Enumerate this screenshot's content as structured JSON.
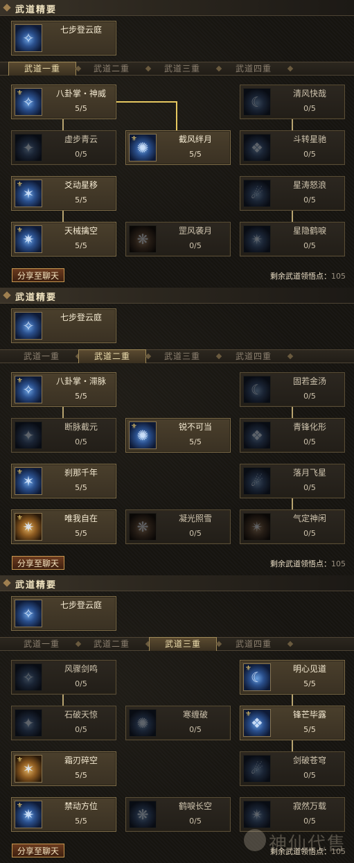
{
  "panels": [
    {
      "header": "武道精要",
      "top_skill": {
        "name": "七步登云庭",
        "icon": "cloud-step-icon"
      },
      "tabs": [
        "武道一重",
        "武道二重",
        "武道三重",
        "武道四重"
      ],
      "active_tab": 0,
      "skills": [
        {
          "name": "八卦掌・神威",
          "level": "5/5",
          "icon": "bagua-palm-icon"
        },
        {
          "name": "清风快哉",
          "level": "0/5",
          "icon": "breeze-icon"
        },
        {
          "name": "虚步青云",
          "level": "0/5",
          "icon": "void-step-icon"
        },
        {
          "name": "截风绊月",
          "level": "5/5",
          "icon": "wind-moon-icon"
        },
        {
          "name": "斗转星驰",
          "level": "0/5",
          "icon": "star-dash-icon"
        },
        {
          "name": "爻动星移",
          "level": "5/5",
          "icon": "star-shift-icon"
        },
        {
          "name": "星涛怒浪",
          "level": "0/5",
          "icon": "star-wave-icon"
        },
        {
          "name": "天械擒空",
          "level": "5/5",
          "icon": "sky-grab-icon"
        },
        {
          "name": "罡风袭月",
          "level": "0/5",
          "icon": "gale-moon-icon"
        },
        {
          "name": "星隐鹤唳",
          "level": "0/5",
          "icon": "crane-cry-icon"
        }
      ],
      "share_label": "分享至聊天",
      "remain_label": "剩余武道领悟点：",
      "remain_value": "105"
    },
    {
      "header": "武道精要",
      "top_skill": {
        "name": "七步登云庭",
        "icon": "cloud-step-icon"
      },
      "tabs": [
        "武道一重",
        "武道二重",
        "武道三重",
        "武道四重"
      ],
      "active_tab": 1,
      "skills": [
        {
          "name": "八卦掌・滞脉",
          "level": "5/5",
          "icon": "bagua-palm-icon"
        },
        {
          "name": "固若金汤",
          "level": "0/5",
          "icon": "iron-wall-icon"
        },
        {
          "name": "断脉截元",
          "level": "0/5",
          "icon": "sever-pulse-icon"
        },
        {
          "name": "锐不可当",
          "level": "5/5",
          "icon": "sharp-icon"
        },
        {
          "name": "青锋化形",
          "level": "0/5",
          "icon": "blade-form-icon"
        },
        {
          "name": "刹那千年",
          "level": "5/5",
          "icon": "instant-icon"
        },
        {
          "name": "落月飞星",
          "level": "0/5",
          "icon": "falling-moon-icon"
        },
        {
          "name": "唯我自在",
          "level": "5/5",
          "icon": "self-icon"
        },
        {
          "name": "凝光照雪",
          "level": "0/5",
          "icon": "light-snow-icon"
        },
        {
          "name": "气定神闲",
          "level": "0/5",
          "icon": "calm-icon"
        }
      ],
      "share_label": "分享至聊天",
      "remain_label": "剩余武道领悟点：",
      "remain_value": "105"
    },
    {
      "header": "武道精要",
      "top_skill": {
        "name": "七步登云庭",
        "icon": "cloud-step-icon"
      },
      "tabs": [
        "武道一重",
        "武道二重",
        "武道三重",
        "武道四重"
      ],
      "active_tab": 2,
      "skills": [
        {
          "name": "风骤剑鸣",
          "level": "0/5",
          "icon": "sword-wind-icon"
        },
        {
          "name": "明心见道",
          "level": "5/5",
          "icon": "enlighten-icon"
        },
        {
          "name": "石破天惊",
          "level": "0/5",
          "icon": "stone-break-icon"
        },
        {
          "name": "寒缠破",
          "level": "0/5",
          "icon": "frost-icon"
        },
        {
          "name": "锋芒毕露",
          "level": "5/5",
          "icon": "edge-icon"
        },
        {
          "name": "霜刃碎空",
          "level": "5/5",
          "icon": "frost-blade-icon"
        },
        {
          "name": "剑破苍穹",
          "level": "0/5",
          "icon": "sky-sword-icon"
        },
        {
          "name": "禁动方位",
          "level": "5/5",
          "icon": "lock-icon"
        },
        {
          "name": "鹤唳长空",
          "level": "0/5",
          "icon": "crane-icon"
        },
        {
          "name": "寂然万载",
          "level": "0/5",
          "icon": "silence-icon"
        }
      ],
      "share_label": "分享至聊天",
      "remain_label": "剩余武道领悟点：",
      "remain_value": "105"
    }
  ],
  "watermark": {
    "text": "神仙代售"
  }
}
